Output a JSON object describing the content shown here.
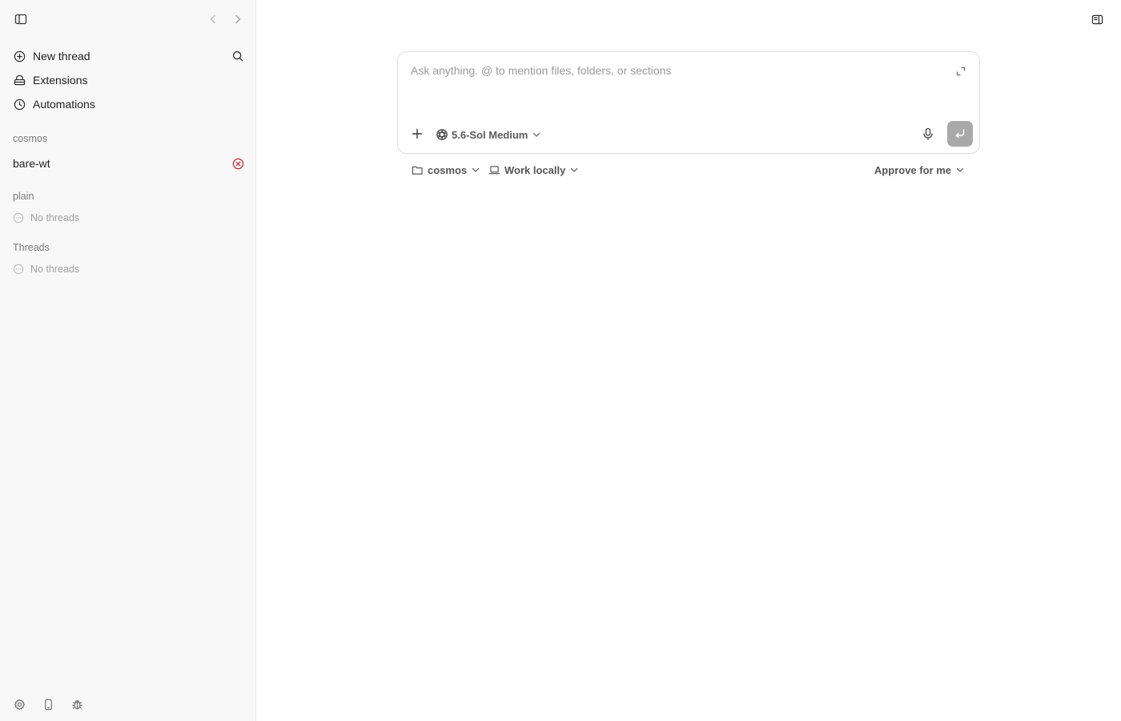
{
  "sidebar": {
    "nav": {
      "new_thread": "New thread",
      "extensions": "Extensions",
      "automations": "Automations"
    },
    "sections": [
      {
        "label": "cosmos",
        "project": "bare-wt",
        "project_status": "error"
      },
      {
        "label": "plain",
        "empty": "No threads"
      },
      {
        "label": "Threads",
        "empty": "No threads"
      }
    ]
  },
  "composer": {
    "placeholder": "Ask anything. @ to mention files, folders, or sections",
    "model": "5.6-Sol Medium"
  },
  "below": {
    "folder": "cosmos",
    "location": "Work locally",
    "approval": "Approve for me"
  },
  "icons": {
    "sidebar_toggle": "sidebar-toggle-icon",
    "back": "chevron-left-icon",
    "forward": "chevron-right-icon",
    "search": "search-icon",
    "error": "x-circle-icon",
    "settings": "gear-icon",
    "phone": "phone-icon",
    "bug": "bug-icon",
    "panel_toggle": "panel-toggle-icon",
    "expand": "expand-icon",
    "plus": "plus-icon",
    "mic": "microphone-icon",
    "send": "send-icon",
    "folder": "folder-icon",
    "laptop": "laptop-icon"
  },
  "colors": {
    "sidebar_bg": "#f8f8f8",
    "error": "#d11a2a",
    "send_disabled": "#a9a9a9"
  }
}
